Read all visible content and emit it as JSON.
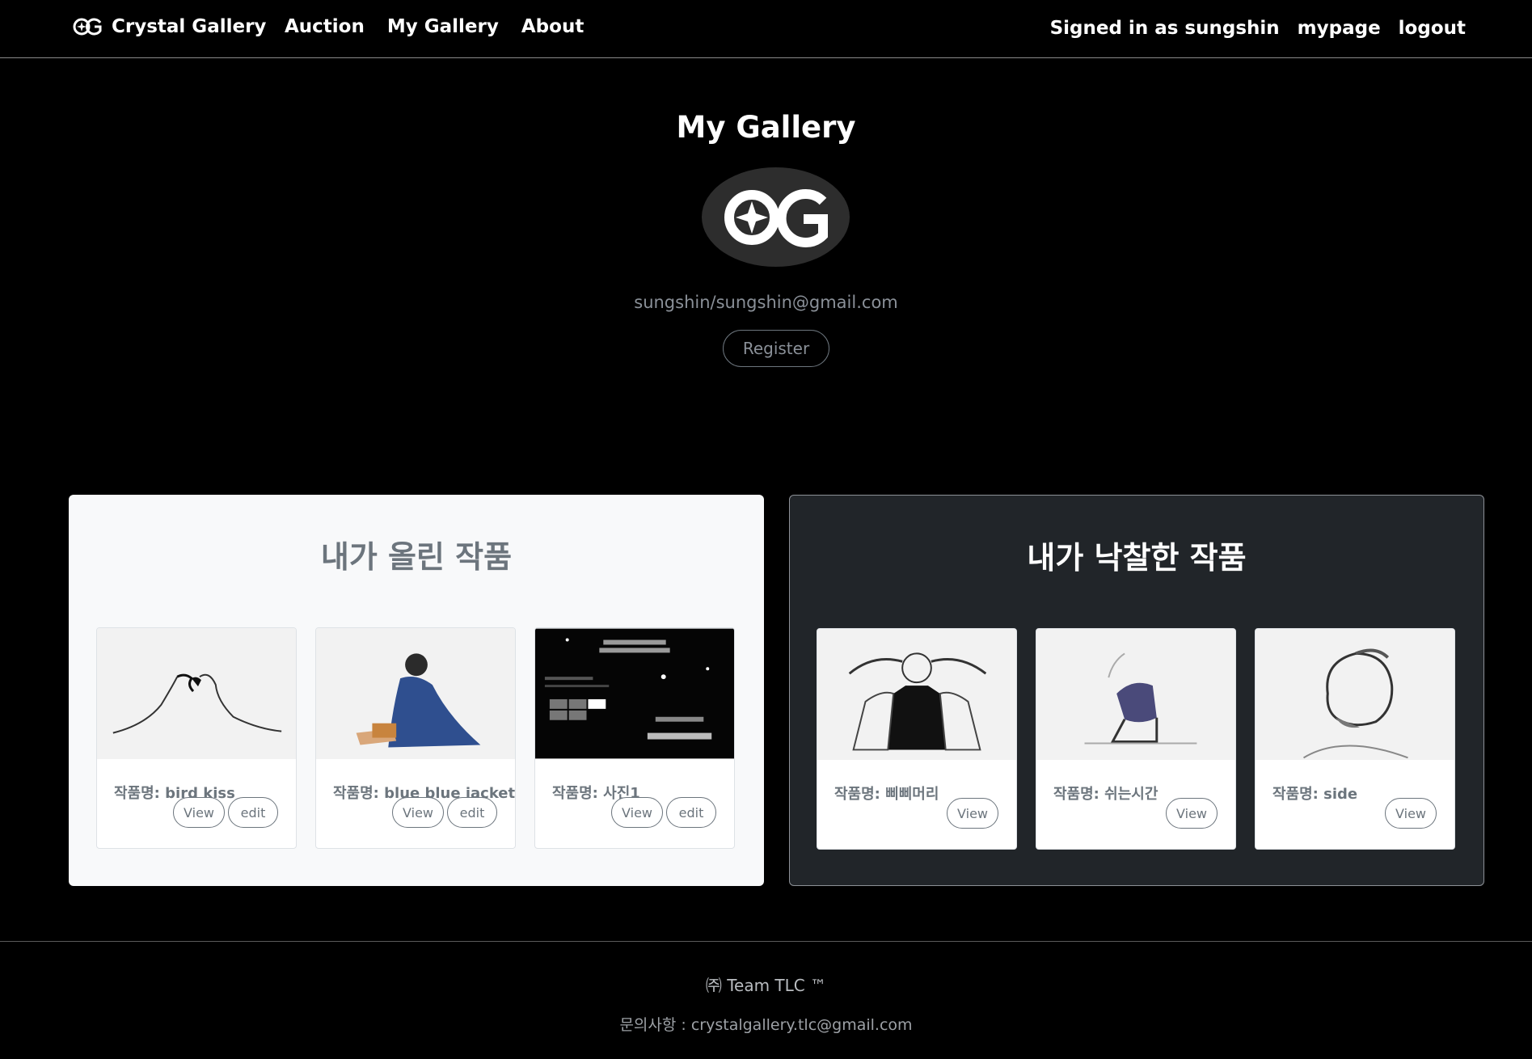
{
  "nav": {
    "brand_label": "Crystal Gallery",
    "links": [
      "Auction",
      "My Gallery",
      "About"
    ],
    "signed_in_text": "Signed in as sungshin",
    "mypage_label": "mypage",
    "logout_label": "logout"
  },
  "profile": {
    "title": "My Gallery",
    "avatar_icon": "cg-logo-icon",
    "user_text": "sungshin/sungshin@gmail.com",
    "register_label": "Register"
  },
  "uploaded": {
    "title": "내가 올린 작품",
    "cards": [
      {
        "title": "작품명: bird kiss",
        "image": "sketch-kiss-image",
        "view_label": "View",
        "edit_label": "edit"
      },
      {
        "title": "작품명: blue blue jacket",
        "image": "sketch-blue-jacket-image",
        "view_label": "View",
        "edit_label": "edit"
      },
      {
        "title": "작품명: 사진1",
        "image": "website-screenshot-image",
        "view_label": "View",
        "edit_label": "edit"
      }
    ]
  },
  "won": {
    "title": "내가 낙찰한 작품",
    "cards": [
      {
        "title": "작품명: 삐삐머리",
        "image": "sketch-pigtails-image",
        "view_label": "View"
      },
      {
        "title": "작품명: 쉬는시간",
        "image": "sketch-resting-image",
        "view_label": "View"
      },
      {
        "title": "작품명: side",
        "image": "sketch-side-profile-image",
        "view_label": "View"
      }
    ]
  },
  "footer": {
    "team": "㈜ Team TLC ™",
    "contact": "문의사항 : crystalgallery.tlc@gmail.com"
  }
}
